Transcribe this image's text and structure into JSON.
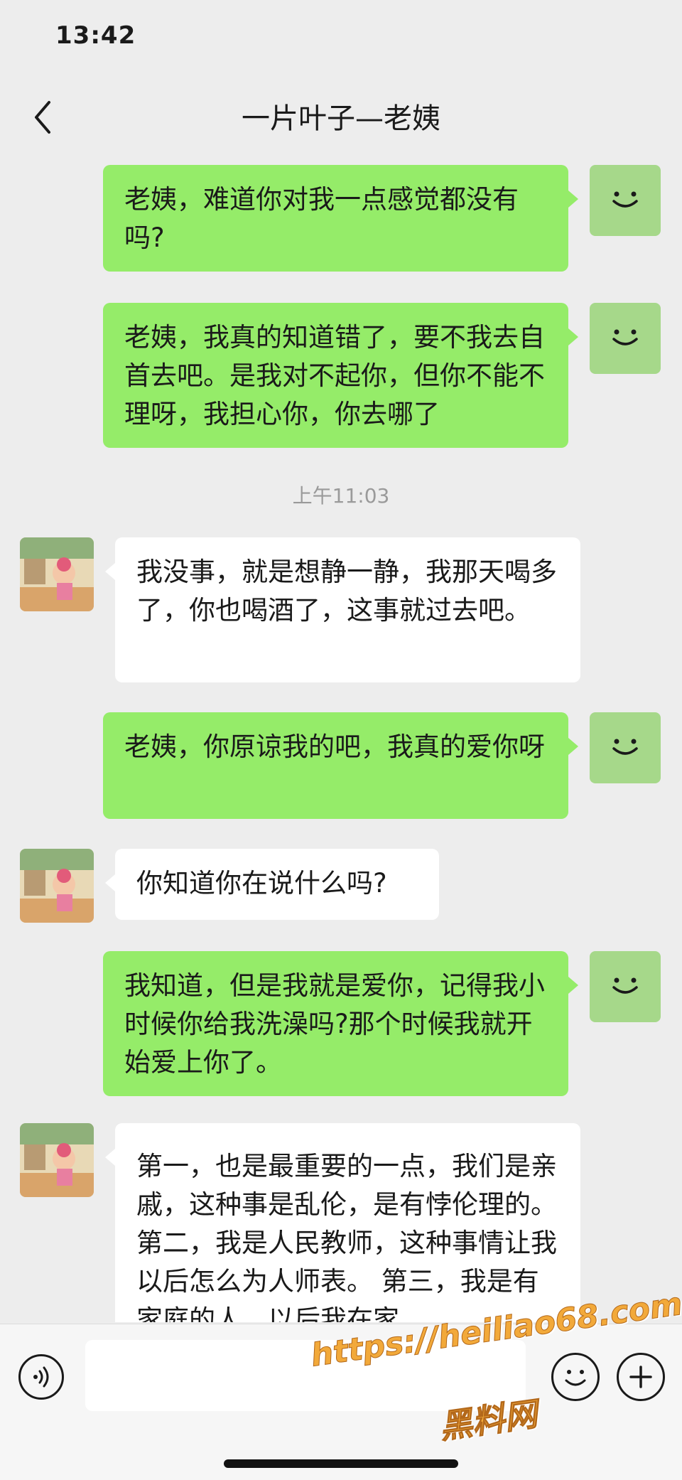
{
  "status_bar": {
    "time": "13:42"
  },
  "nav": {
    "title": "一片叶子—老姨",
    "back_icon": "chevron-left-icon"
  },
  "messages": [
    {
      "side": "out",
      "text": "老姨，难道你对我一点感觉都没有吗?"
    },
    {
      "side": "out",
      "text": "老姨，我真的知道错了，要不我去自首去吧。是我对不起你，但你不能不理呀，我担心你，你去哪了"
    },
    {
      "side": "in",
      "text": "我没事，就是想静一静，我那天喝多了，你也喝酒了，这事就过去吧。"
    },
    {
      "side": "out",
      "text": "老姨，你原谅我的吧，我真的爱你呀"
    },
    {
      "side": "in",
      "text": "你知道你在说什么吗?"
    },
    {
      "side": "out",
      "text": "我知道，但是我就是爱你，记得我小时候你给我洗澡吗?那个时候我就开始爱上你了。"
    },
    {
      "side": "in",
      "text": "第一，也是最重要的一点，我们是亲戚，这种事是乱伦，是有悖伦理的。 第二，我是人民教师，这种事情让我以后怎么为人师表。 第三，我是有家庭的人，以后我在家"
    }
  ],
  "timestamp": "上午11:03",
  "input_bar": {
    "placeholder": ""
  },
  "watermark": {
    "url": "https://heiliao68.com",
    "brand": "黑料网"
  },
  "colors": {
    "outgoing_bubble": "#95ec69",
    "incoming_bubble": "#ffffff",
    "background": "#ededed"
  }
}
